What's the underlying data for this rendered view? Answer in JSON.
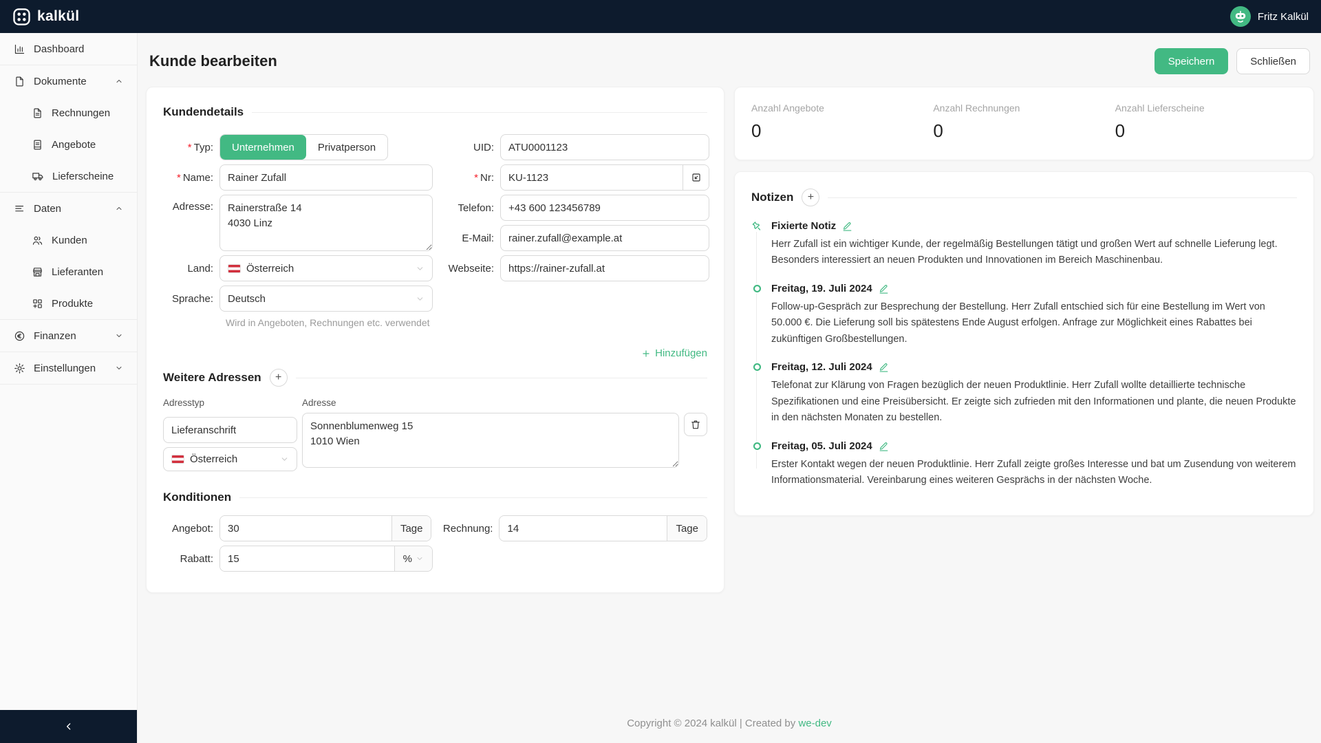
{
  "colors": {
    "accent": "#42b983",
    "topbar": "#0d1b2d",
    "required": "#f5222d"
  },
  "topbar": {
    "brand": "kalkül",
    "user": "Fritz Kalkül"
  },
  "sidebar": {
    "dashboard": "Dashboard",
    "dokumente": "Dokumente",
    "rechnungen": "Rechnungen",
    "angebote": "Angebote",
    "lieferscheine": "Lieferscheine",
    "daten": "Daten",
    "kunden": "Kunden",
    "lieferanten": "Lieferanten",
    "produkte": "Produkte",
    "finanzen": "Finanzen",
    "einstellungen": "Einstellungen"
  },
  "header": {
    "title": "Kunde bearbeiten",
    "save": "Speichern",
    "close": "Schließen"
  },
  "form": {
    "required_marker": "*",
    "section_details": "Kundendetails",
    "typ_label": "Typ:",
    "typ_options": [
      "Unternehmen",
      "Privatperson"
    ],
    "name_label": "Name:",
    "name_value": "Rainer Zufall",
    "adresse_label": "Adresse:",
    "adresse_value": "Rainerstraße 14\n4030 Linz",
    "land_label": "Land:",
    "land_value": "Österreich",
    "sprache_label": "Sprache:",
    "sprache_value": "Deutsch",
    "sprache_hint": "Wird in Angeboten, Rechnungen etc. verwendet",
    "uid_label": "UID:",
    "uid_value": "ATU0001123",
    "nr_label": "Nr:",
    "nr_value": "KU-1123",
    "telefon_label": "Telefon:",
    "telefon_value": "+43 600 123456789",
    "email_label": "E-Mail:",
    "email_value": "rainer.zufall@example.at",
    "webseite_label": "Webseite:",
    "webseite_value": "https://rainer-zufall.at",
    "add_link": "Hinzufügen",
    "section_addresses": "Weitere Adressen",
    "addr_col1": "Adresstyp",
    "addr_col2": "Adresse",
    "addr_type_value": "Lieferanschrift",
    "addr_country_value": "Österreich",
    "addr_value": "Sonnenblumenweg 15\n1010 Wien",
    "section_conditions": "Konditionen",
    "angebot_label": "Angebot:",
    "angebot_value": "30",
    "angebot_unit": "Tage",
    "rechnung_label": "Rechnung:",
    "rechnung_value": "14",
    "rechnung_unit": "Tage",
    "rabatt_label": "Rabatt:",
    "rabatt_value": "15",
    "rabatt_unit": "%"
  },
  "stats": [
    {
      "label": "Anzahl Angebote",
      "value": "0"
    },
    {
      "label": "Anzahl Rechnungen",
      "value": "0"
    },
    {
      "label": "Anzahl Lieferscheine",
      "value": "0"
    }
  ],
  "notes": {
    "title": "Notizen",
    "items": [
      {
        "title": "Fixierte Notiz",
        "text": "Herr Zufall ist ein wichtiger Kunde, der regelmäßig Bestellungen tätigt und großen Wert auf schnelle Lieferung legt. Besonders interessiert an neuen Produkten und Innovationen im Bereich Maschinenbau."
      },
      {
        "title": "Freitag, 19. Juli 2024",
        "text": "Follow-up-Gespräch zur Besprechung der Bestellung. Herr Zufall entschied sich für eine Bestellung im Wert von 50.000 €. Die Lieferung soll bis spätestens Ende August erfolgen. Anfrage zur Möglichkeit eines Rabattes bei zukünftigen Großbestellungen."
      },
      {
        "title": "Freitag, 12. Juli 2024",
        "text": "Telefonat zur Klärung von Fragen bezüglich der neuen Produktlinie. Herr Zufall wollte detaillierte technische Spezifikationen und eine Preisübersicht. Er zeigte sich zufrieden mit den Informationen und plante, die neuen Produkte in den nächsten Monaten zu bestellen."
      },
      {
        "title": "Freitag, 05. Juli 2024",
        "text": "Erster Kontakt wegen der neuen Produktlinie. Herr Zufall zeigte großes Interesse und bat um Zusendung von weiterem Informationsmaterial. Vereinbarung eines weiteren Gesprächs in der nächsten Woche."
      }
    ]
  },
  "footer": {
    "copyright": "Copyright © 2024 kalkül | Created by",
    "link_label": "we-dev"
  }
}
